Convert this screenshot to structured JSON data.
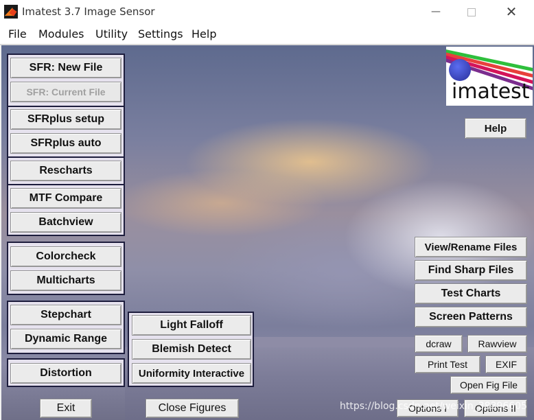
{
  "window": {
    "title": "Imatest 3.7  Image Sensor",
    "controls": {
      "minimize": "—",
      "close": "✕"
    }
  },
  "menu": [
    "File",
    "Modules",
    "Utility",
    "Settings",
    "Help"
  ],
  "logo": {
    "text": "imatest",
    "stripe_colors": [
      "#d4145a",
      "#7b2d8e",
      "#2ebf3c",
      "#e8403c"
    ]
  },
  "left_buttons": {
    "sfr_new_file": "SFR: New File",
    "sfr_current_file": "SFR: Current File",
    "sfrplus_setup": "SFRplus  setup",
    "sfrplus_auto": "SFRplus  auto",
    "rescharts": "Rescharts",
    "mtf_compare": "MTF Compare",
    "batchview": "Batchview",
    "colorcheck": "Colorcheck",
    "multicharts": "Multicharts",
    "stepchart": "Stepchart",
    "dynamic_range": "Dynamic Range",
    "distortion": "Distortion"
  },
  "middle_buttons": {
    "light_falloff": "Light Falloff",
    "blemish_detect": "Blemish Detect",
    "uniformity_interactive": "Uniformity Interactive"
  },
  "right_buttons": {
    "help": "Help",
    "view_rename_files": "View/Rename Files",
    "find_sharp_files": "Find Sharp Files",
    "test_charts": "Test Charts",
    "screen_patterns": "Screen Patterns",
    "dcraw": "dcraw",
    "rawview": "Rawview",
    "print_test": "Print Test",
    "exif": "EXIF",
    "open_fig_file": "Open Fig File",
    "options_1": "Options I",
    "options_2": "Options II"
  },
  "bottom_buttons": {
    "exit": "Exit",
    "close_figures": "Close Figures"
  },
  "watermark": "https://blog.csdn.net/weixin_38396605"
}
